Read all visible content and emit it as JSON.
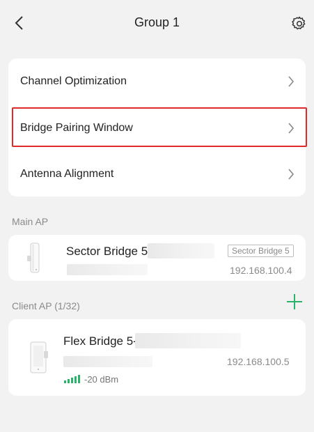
{
  "header": {
    "title": "Group 1",
    "back_icon": "chevron-left-icon",
    "settings_icon": "gear-icon"
  },
  "menu": {
    "items": [
      {
        "label": "Channel Optimization"
      },
      {
        "label": "Bridge Pairing Window"
      },
      {
        "label": "Antenna Alignment"
      }
    ]
  },
  "main_ap": {
    "section_label": "Main AP",
    "name": "Sector Bridge 5-",
    "tag": "Sector Bridge 5",
    "ip": "192.168.100.4"
  },
  "client_ap": {
    "section_label": "Client AP (1/32)",
    "add_icon": "plus-icon",
    "devices": [
      {
        "name": "Flex Bridge 5-",
        "ip": "192.168.100.5",
        "signal": "-20 dBm"
      }
    ]
  },
  "colors": {
    "accent_green": "#2bb36b",
    "highlight_red": "#e02a2a",
    "background": "#f2f2f2"
  }
}
